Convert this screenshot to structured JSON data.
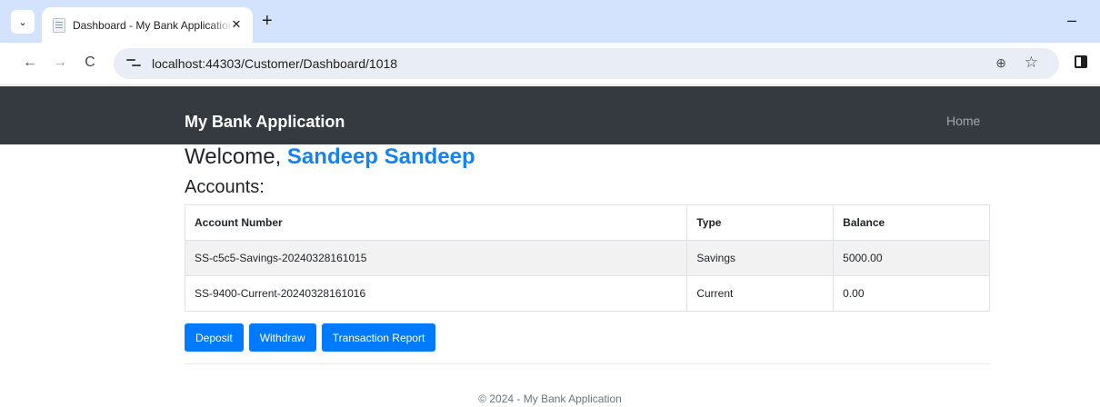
{
  "browser": {
    "tab_title": "Dashboard - My Bank Application",
    "tab_close_glyph": "✕",
    "new_tab_glyph": "+",
    "minimize_glyph": "–",
    "back_glyph": "←",
    "forward_glyph": "→",
    "reload_glyph": "C",
    "url": "localhost:44303/Customer/Dashboard/1018",
    "zoom_glyph": "⊕",
    "star_glyph": "☆",
    "tab_menu_glyph": "⌄"
  },
  "navbar": {
    "brand": "My Bank Application",
    "home_link": "Home"
  },
  "dashboard": {
    "welcome_prefix": "Welcome, ",
    "user_name": "Sandeep Sandeep",
    "accounts_heading": "Accounts:"
  },
  "accounts_table": {
    "headers": [
      "Account Number",
      "Type",
      "Balance"
    ],
    "rows": [
      [
        "SS-c5c5-Savings-20240328161015",
        "Savings",
        "5000.00"
      ],
      [
        "SS-9400-Current-20240328161016",
        "Current",
        "0.00"
      ]
    ]
  },
  "actions": {
    "deposit": "Deposit",
    "withdraw": "Withdraw",
    "transaction_report": "Transaction Report"
  },
  "footer": {
    "text": "© 2024 - My Bank Application"
  },
  "colors": {
    "navbar_bg": "#343a40",
    "primary": "#007bff",
    "user_name": "#1582f2"
  }
}
